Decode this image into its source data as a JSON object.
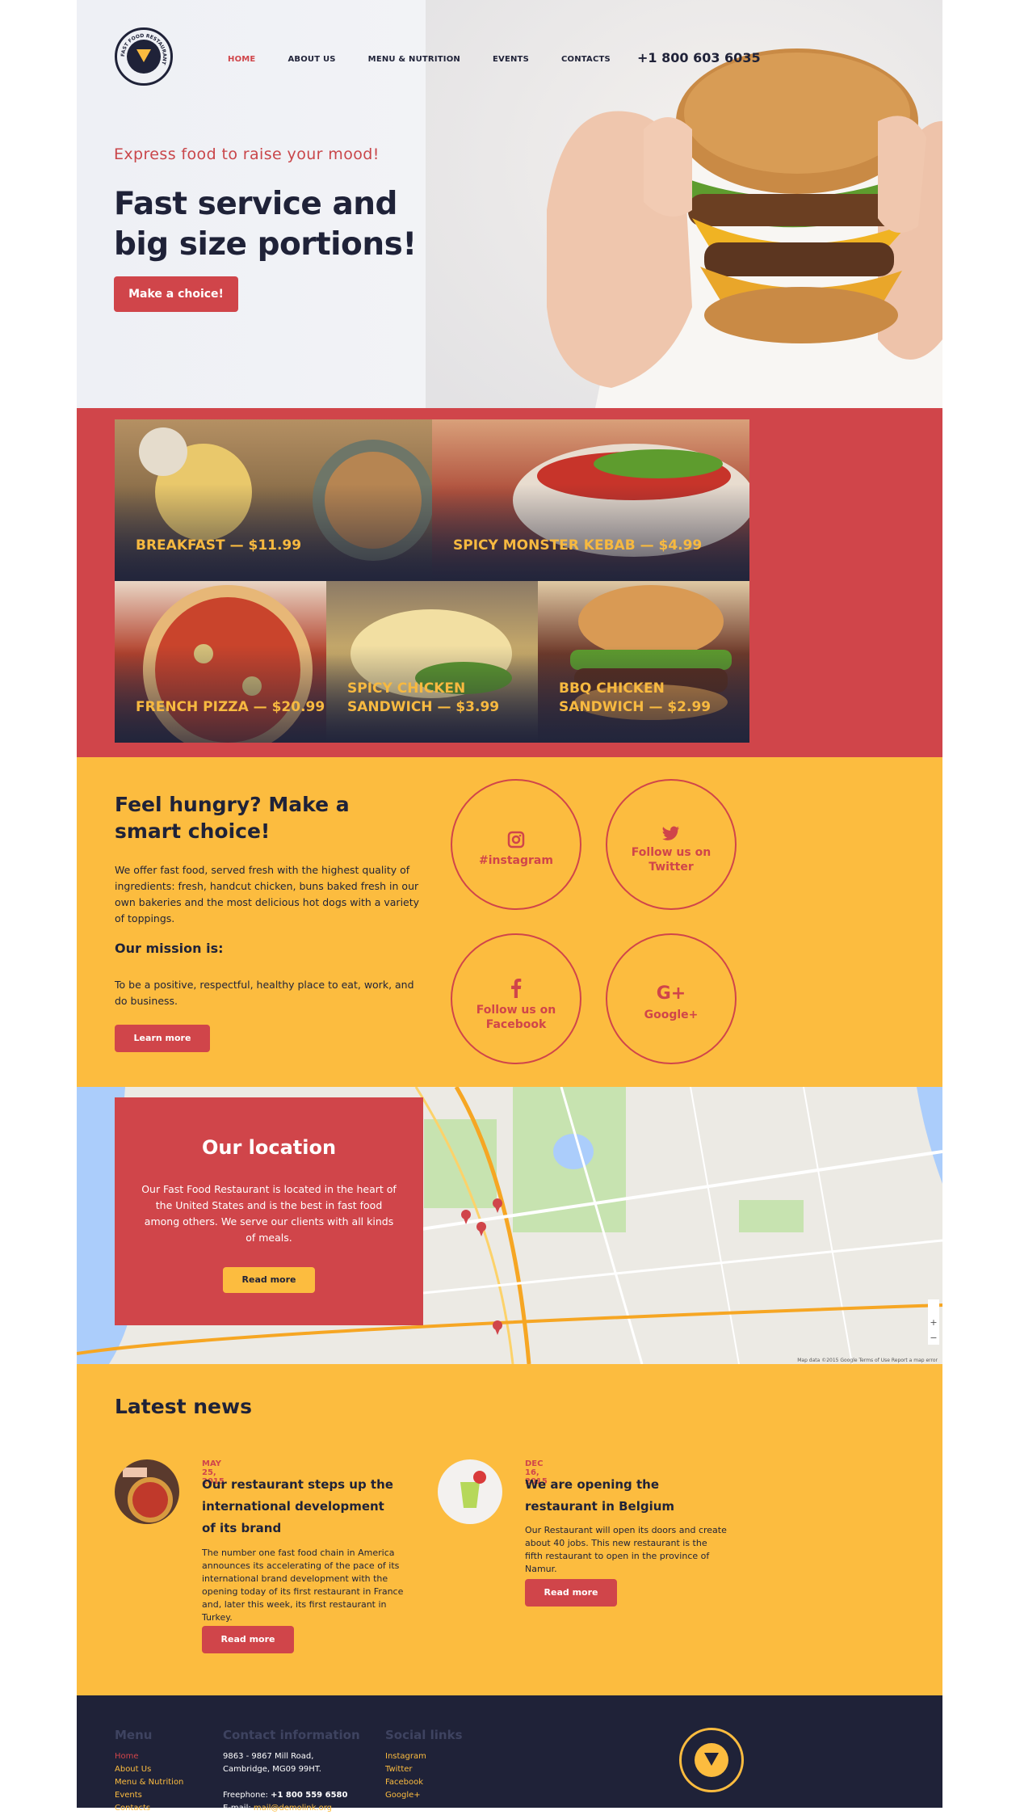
{
  "header": {
    "logo_text": "FAST FOOD RESTAURANT",
    "nav": [
      {
        "label": "HOME"
      },
      {
        "label": "ABOUT US"
      },
      {
        "label": "MENU & NUTRITION"
      },
      {
        "label": "EVENTS"
      },
      {
        "label": "CONTACTS"
      }
    ],
    "phone": "+1 800 603 6035"
  },
  "hero": {
    "tagline": "Express food to raise your mood!",
    "headline": "Fast service and big size portions!",
    "button": "Make a choice!"
  },
  "menu_tiles": [
    {
      "label": "BREAKFAST — $11.99"
    },
    {
      "label": "SPICY MONSTER KEBAB — $4.99"
    },
    {
      "label": "FRENCH PIZZA — $20.99"
    },
    {
      "label": "SPICY CHICKEN SANDWICH — $3.99"
    },
    {
      "label": "BBQ CHICKEN SANDWICH — $2.99"
    }
  ],
  "about": {
    "title": "Feel hungry? Make a smart choice!",
    "text": "We offer fast food, served fresh with the highest quality of ingredients: fresh, handcut chicken, buns baked fresh in our own bakeries and the most delicious hot dogs with a variety of toppings.",
    "mission_title": "Our mission is:",
    "mission_text": "To be a positive, respectful, healthy place to eat, work, and do business.",
    "button": "Learn more"
  },
  "social_circles": [
    {
      "icon": "instagram-icon",
      "label": "#instagram"
    },
    {
      "icon": "twitter-icon",
      "label": "Follow us on Twitter"
    },
    {
      "icon": "facebook-icon",
      "label": "Follow us on Facebook"
    },
    {
      "icon": "google-plus-icon",
      "label": "Google+"
    }
  ],
  "location": {
    "title": "Our location",
    "text": "Our Fast Food Restaurant is located in the heart of the United States and is the best in fast food among others. We serve our clients with all kinds of meals.",
    "button": "Read more",
    "map_credit": "Map data ©2015 Google   Terms of Use   Report a map error"
  },
  "news": {
    "title": "Latest news",
    "items": [
      {
        "date": "MAY 25, 2015",
        "title": "Our restaurant steps up the international development of its brand",
        "text": "The number one fast food chain in America announces its accelerating of the pace of its international brand development with the opening today of its first restaurant in France and, later this week, its first restaurant in Turkey.",
        "button": "Read more"
      },
      {
        "date": "DEC 16, 2015",
        "title": "We are opening the restaurant in Belgium",
        "text": "Our Restaurant will open its doors and create about 40 jobs. This new restaurant is the fifth restaurant to open in the province of Namur.",
        "button": "Read more"
      }
    ]
  },
  "footer": {
    "menu_title": "Menu",
    "menu_items": [
      "Home",
      "About Us",
      "Menu & Nutrition",
      "Events",
      "Contacts"
    ],
    "contact_title": "Contact information",
    "address_line1": "9863 - 9867 Mill Road,",
    "address_line2": "Cambridge, MG09 99HT.",
    "freephone_label": "Freephone:",
    "freephone": "+1 800 559 6580",
    "email_label": "E-mail:",
    "email": "mail@demolink.org",
    "social_title": "Social links",
    "social_items": [
      "Instagram",
      "Twitter",
      "Facebook",
      "Google+"
    ]
  },
  "colors": {
    "red": "#d0454a",
    "yellow": "#fcbc3f",
    "navy": "#1f2238"
  }
}
